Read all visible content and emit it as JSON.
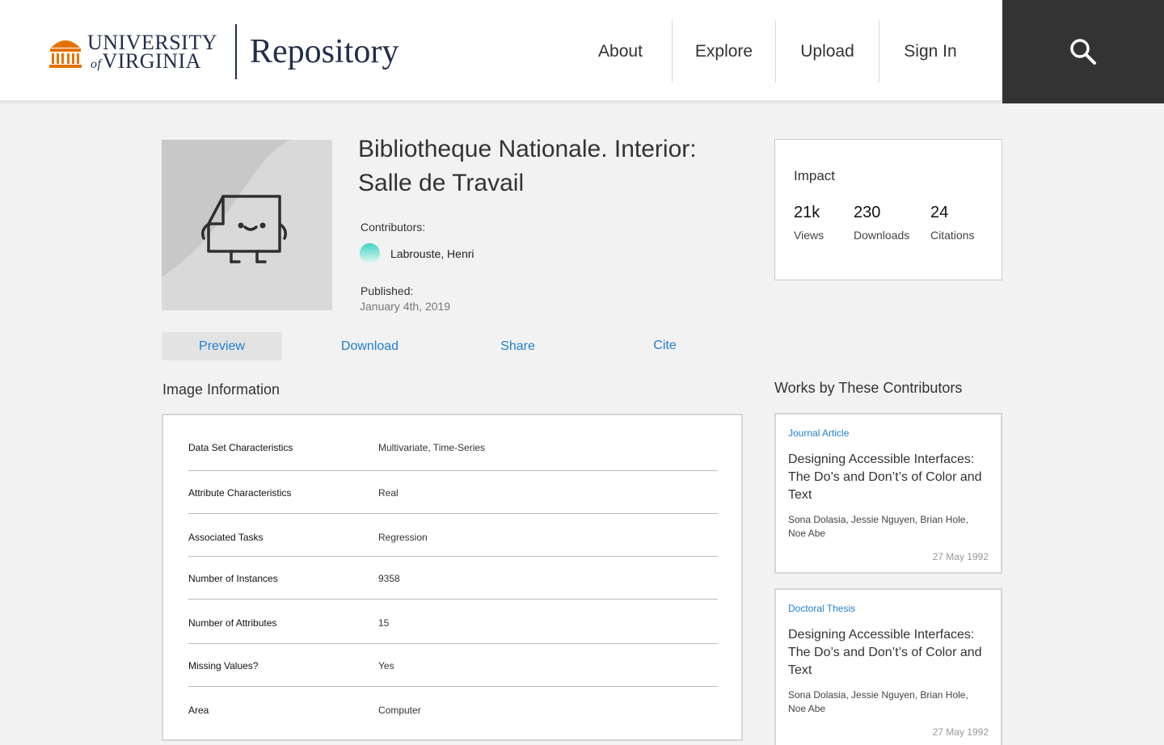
{
  "header": {
    "logo": {
      "uva_line1": "UNIVERSITY",
      "uva_of": "of",
      "uva_line2": "VIRGINIA",
      "repository": "Repository"
    },
    "nav": [
      "About",
      "Explore",
      "Upload",
      "Sign In"
    ],
    "search_icon": "search-icon",
    "colors": {
      "brand_navy": "#232d4b",
      "brand_orange": "#e57200",
      "search_bg": "#333333"
    }
  },
  "item": {
    "title": "Bibliotheque Nationale. Interior: Salle de Travail",
    "contributors_label": "Contributors:",
    "contributor": "Labrouste, Henri",
    "published_label": "Published:",
    "published_date": "January 4th, 2019",
    "placeholder_icon": "file-character-icon"
  },
  "impact": {
    "title": "Impact",
    "stats": [
      {
        "value": "21k",
        "label": "Views"
      },
      {
        "value": "230",
        "label": "Downloads"
      },
      {
        "value": "24",
        "label": "Citations"
      }
    ]
  },
  "tabs": [
    {
      "label": "Preview",
      "active": true
    },
    {
      "label": "Download",
      "active": false
    },
    {
      "label": "Share",
      "active": false
    },
    {
      "label": "Cite",
      "active": false
    }
  ],
  "image_info": {
    "title": "Image Information",
    "rows": [
      {
        "key": "Data Set Characteristics",
        "value": "Multivariate, Time-Series"
      },
      {
        "key": "Attribute Characteristics",
        "value": "Real"
      },
      {
        "key": "Associated Tasks",
        "value": "Regression"
      },
      {
        "key": "Number of Instances",
        "value": "9358"
      },
      {
        "key": "Number of Attributes",
        "value": "15"
      },
      {
        "key": "Missing Values?",
        "value": "Yes"
      },
      {
        "key": "Area",
        "value": "Computer"
      }
    ]
  },
  "works": {
    "title": "Works by These Contributors",
    "items": [
      {
        "type": "Journal Article",
        "title": "Designing Accessible Interfaces: The Do’s and Don’t’s of Color and Text",
        "authors": "Sona Dolasia, Jessie Nguyen, Brian Hole, Noe Abe",
        "date": "27 May 1992"
      },
      {
        "type": "Doctoral Thesis",
        "title": "Designing Accessible Interfaces: The Do’s and Don’t’s of Color and Text",
        "authors": "Sona Dolasia, Jessie Nguyen, Brian Hole, Noe Abe",
        "date": "27 May 1992"
      }
    ]
  }
}
